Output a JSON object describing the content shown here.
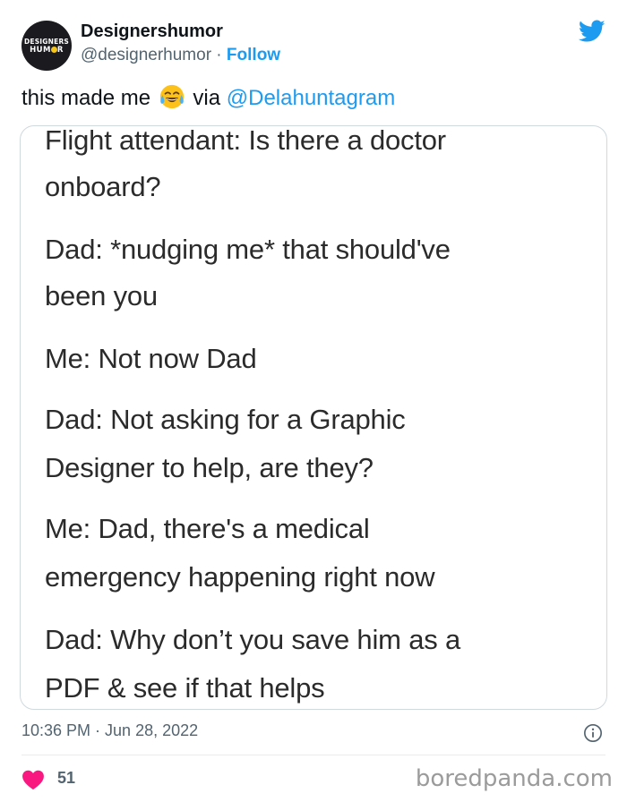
{
  "author": {
    "avatar_line1": "DESIGNERS",
    "avatar_line2a": "HUM",
    "avatar_line2b": "R",
    "name": "Designershumor",
    "handle": "@designerhumor",
    "separator": " · ",
    "follow_label": "Follow"
  },
  "tweet": {
    "text_before": "this made me ",
    "emoji": "face-with-tears-of-joy",
    "text_mid": " via ",
    "mention": "@Delahuntagram"
  },
  "card": {
    "lines": [
      "Flight attendant: Is there a doctor",
      "onboard?",
      "Dad: *nudging me* that should've",
      "been you",
      "Me: Not now Dad",
      "Dad: Not asking for a Graphic",
      "Designer to help, are they?",
      "Me: Dad, there's a medical",
      "emergency happening right now",
      "Dad: Why don’t you save him as a",
      "PDF & see if that helps"
    ]
  },
  "meta": {
    "time": "10:36 PM",
    "dot": " · ",
    "date": "Jun 28, 2022",
    "likes": "51"
  },
  "watermark": "boredpanda.com",
  "colors": {
    "accent": "#1d9bf0",
    "like": "#f91880",
    "text": "#0f1419",
    "muted": "#536471"
  },
  "icons": [
    "twitter-bird-icon",
    "info-icon",
    "heart-icon"
  ]
}
